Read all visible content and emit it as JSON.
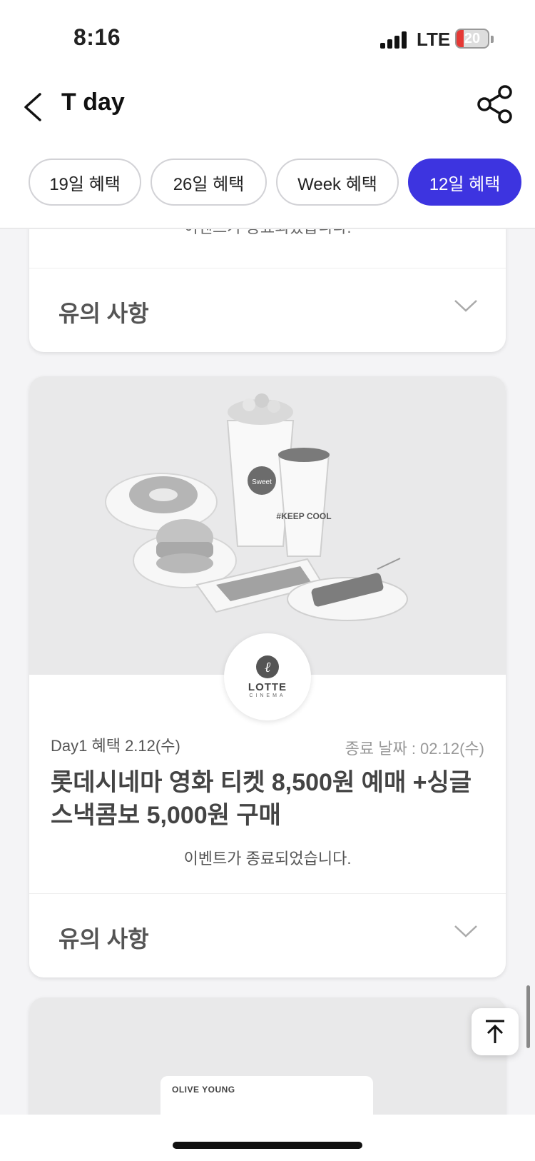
{
  "status_bar": {
    "time": "8:16",
    "network": "LTE",
    "battery": "20"
  },
  "header": {
    "title": "T day",
    "back_icon": "chevron-left-icon",
    "share_icon": "share-icon"
  },
  "tabs": [
    {
      "label": "19일 혜택",
      "active": false
    },
    {
      "label": "26일 혜택",
      "active": false
    },
    {
      "label": "Week 혜택",
      "active": false
    },
    {
      "label": "12일 혜택",
      "active": true
    }
  ],
  "cards": [
    {
      "status": "이벤트가 종료되었습니다.",
      "notice_label": "유의 사항"
    },
    {
      "brand_logo": {
        "name": "LOTTE",
        "sub": "CINEMA"
      },
      "image_text": {
        "cup_label": "Sweet",
        "drink_label": "#KEEP COOL"
      },
      "day_label": "Day1 혜택 2.12(수)",
      "end_date": "종료 날짜 : 02.12(수)",
      "title": "롯데시네마 영화 티켓 8,500원 예매 +싱글스낵콤보 5,000원 구매",
      "status": "이벤트가 종료되었습니다.",
      "notice_label": "유의 사항"
    },
    {
      "brand_logo": {
        "name": "OLIVE YOUNG"
      }
    }
  ],
  "floating": {
    "scroll_top_icon": "arrow-up-to-top-icon"
  },
  "colors": {
    "accent": "#3d34e0",
    "battery_low": "#e53935"
  }
}
